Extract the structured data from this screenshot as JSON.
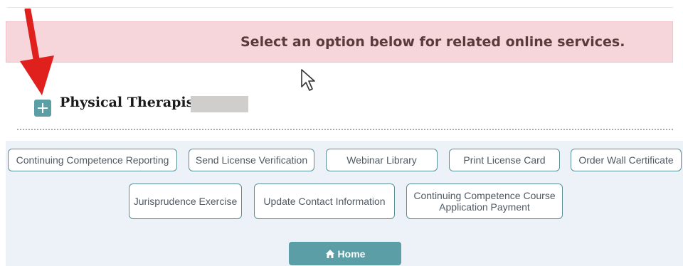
{
  "banner": {
    "message": "Select an option below for related online services."
  },
  "profession": {
    "title": "Physical Therapist"
  },
  "services": {
    "row1": [
      "Continuing Competence Reporting",
      "Send License Verification",
      "Webinar Library",
      "Print License Card",
      "Order Wall Certificate"
    ],
    "row2": [
      "Jurisprudence Exercise",
      "Update Contact Information",
      "Continuing Competence Course Application Payment"
    ]
  },
  "home": {
    "label": "Home",
    "icon": "home-icon"
  },
  "colors": {
    "banner_bg": "#f6d6da",
    "accent_teal": "#5b9ea5",
    "arrow_red": "#e0201d"
  }
}
